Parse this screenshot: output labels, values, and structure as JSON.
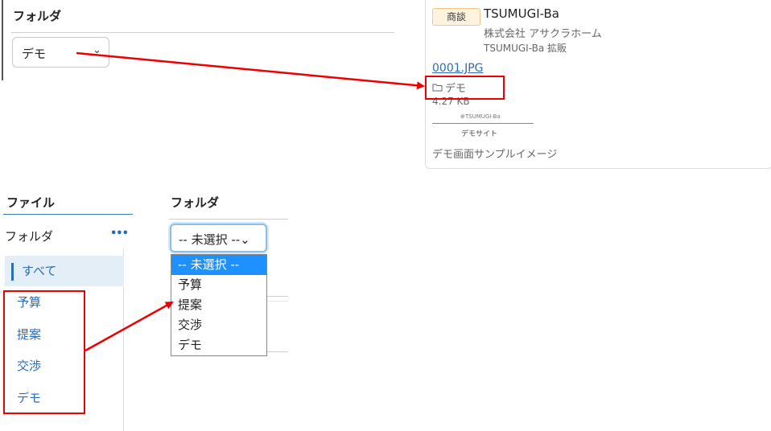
{
  "top_left": {
    "title": "フォルダ",
    "select_value": "デモ",
    "chevron": "⌄"
  },
  "card": {
    "badge": "商談",
    "name": "TSUMUGI-Ba",
    "company": "株式会社 アサクラホーム",
    "department": "TSUMUGI-Ba 拡販",
    "file_name": "0001.JPG",
    "folder": "デモ",
    "size": "4.27 KB",
    "thumb_logo": "⊕TSUMUGI-Ba",
    "thumb_sub": "デモサイト",
    "caption": "デモ画面サンプルイメージ"
  },
  "sidebar": {
    "title": "ファイル",
    "folder_label": "フォルダ",
    "more": "•••",
    "items": [
      {
        "label": "すべて",
        "active": true
      },
      {
        "label": "予算",
        "active": false
      },
      {
        "label": "提案",
        "active": false
      },
      {
        "label": "交渉",
        "active": false
      },
      {
        "label": "デモ",
        "active": false
      }
    ]
  },
  "folder_panel": {
    "title": "フォルダ",
    "select_value": "-- 未選択 --⌄",
    "options": [
      "-- 未選択 --",
      "予算",
      "提案",
      "交渉",
      "デモ"
    ],
    "selected_index": 0
  },
  "colors": {
    "accent": "#2a6db3",
    "highlight": "#e00000",
    "option_selected": "#1e90ff"
  }
}
